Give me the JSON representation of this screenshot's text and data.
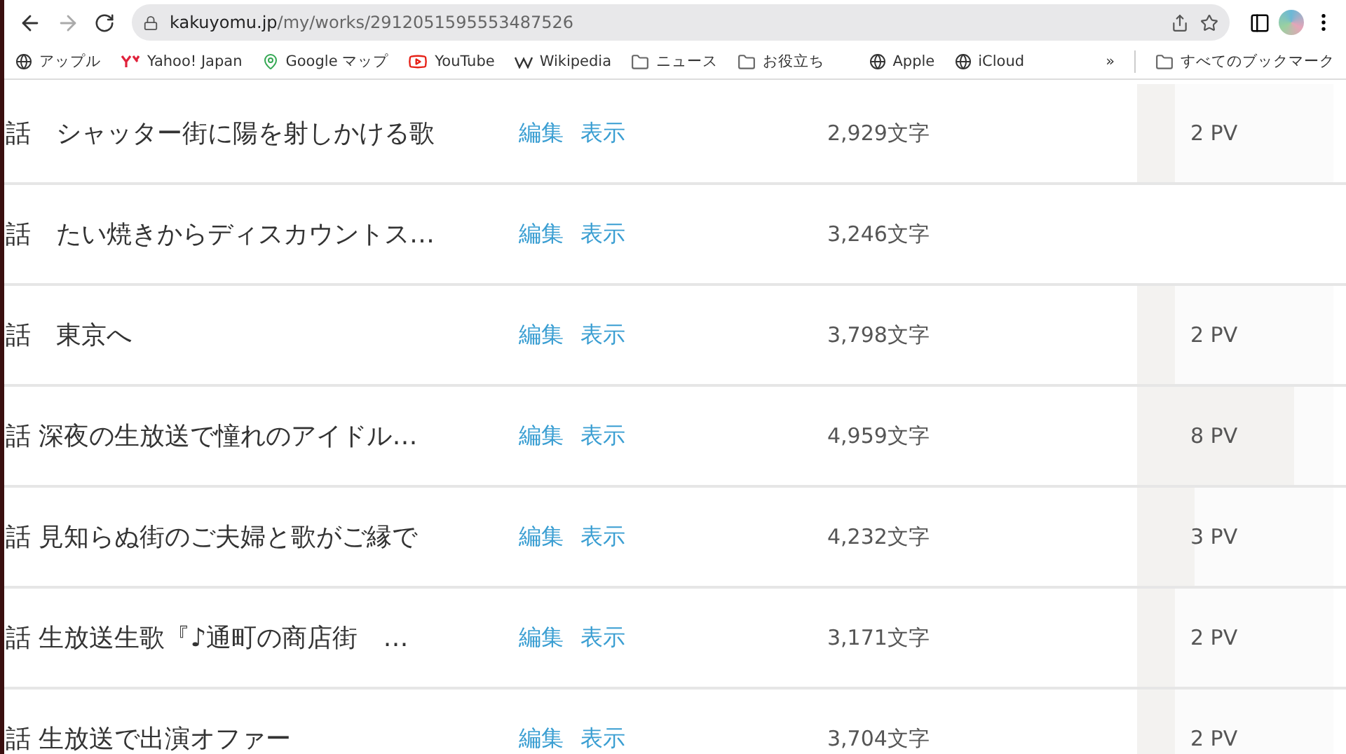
{
  "browser": {
    "url_host": "kakuyomu.jp",
    "url_path": "/my/works/2912051595553487526",
    "bookmarks": [
      {
        "label": "アップル",
        "kind": "globe"
      },
      {
        "label": "Yahoo! Japan",
        "kind": "yahoo"
      },
      {
        "label": "Google マップ",
        "kind": "maps"
      },
      {
        "label": "YouTube",
        "kind": "youtube"
      },
      {
        "label": "Wikipedia",
        "kind": "wiki"
      },
      {
        "label": "ニュース",
        "kind": "folder"
      },
      {
        "label": "お役立ち",
        "kind": "folder"
      }
    ],
    "bookmarks_right": [
      {
        "label": "Apple",
        "kind": "globe"
      },
      {
        "label": "iCloud",
        "kind": "globe"
      }
    ],
    "more": "»",
    "all_bookmarks": "すべてのブックマーク"
  },
  "episodes": [
    {
      "title": "話　シャッター街に陽を射しかける歌",
      "edit": "編集",
      "view": "表示",
      "chars": "2,929文字",
      "pv": "2 PV",
      "level": 0.19
    },
    {
      "title": "話　たい焼きからディスカウントス…",
      "edit": "編集",
      "view": "表示",
      "chars": "3,246文字"
    },
    {
      "title": "話　東京へ",
      "edit": "編集",
      "view": "表示",
      "chars": "3,798文字",
      "pv": "2 PV",
      "level": 0.19
    },
    {
      "title": "話 深夜の生放送で憧れのアイドル…",
      "edit": "編集",
      "view": "表示",
      "chars": "4,959文字",
      "pv": "8 PV",
      "level": 0.8
    },
    {
      "title": "話 見知らぬ街のご夫婦と歌がご縁で",
      "edit": "編集",
      "view": "表示",
      "chars": "4,232文字",
      "pv": "3 PV",
      "level": 0.29
    },
    {
      "title": "話 生放送生歌『♪通町の商店街　…",
      "edit": "編集",
      "view": "表示",
      "chars": "3,171文字",
      "pv": "2 PV",
      "level": 0.19
    },
    {
      "title": "話 生放送で出演オファー",
      "edit": "編集",
      "view": "表示",
      "chars": "3,704文字",
      "pv": "2 PV",
      "level": 0.19
    }
  ]
}
